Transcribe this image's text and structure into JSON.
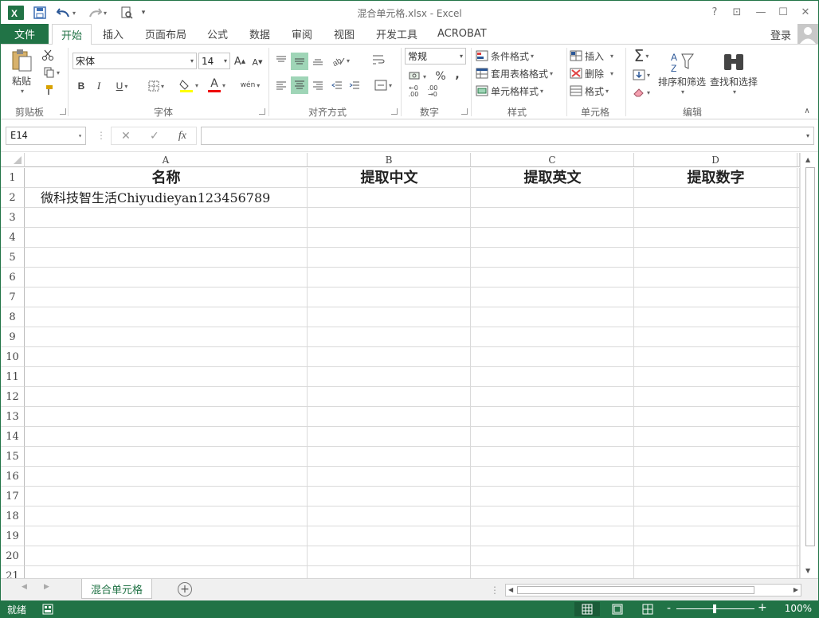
{
  "window": {
    "title": "混合单元格.xlsx - Excel",
    "help": "?",
    "restore_ribbon": "⊡",
    "minimize": "—",
    "maximize": "☐",
    "close": "✕"
  },
  "quick_access": {
    "app_icon": "X",
    "dropdown": "▾"
  },
  "ribbon_tabs": {
    "file": "文件",
    "home": "开始",
    "insert": "插入",
    "page_layout": "页面布局",
    "formulas": "公式",
    "data": "数据",
    "review": "审阅",
    "view": "视图",
    "developer": "开发工具",
    "acrobat": "ACROBAT",
    "login": "登录"
  },
  "clipboard": {
    "paste": "粘贴",
    "group": "剪贴板"
  },
  "font": {
    "name": "宋体",
    "size": "14",
    "bold": "B",
    "italic": "I",
    "underline": "U",
    "grow": "A",
    "shrink": "A",
    "font_color": "A",
    "phonetic": "wén",
    "group": "字体"
  },
  "alignment": {
    "group": "对齐方式"
  },
  "number": {
    "format": "常规",
    "percent": "%",
    "comma": ",",
    "group": "数字"
  },
  "styles": {
    "conditional": "条件格式",
    "table": "套用表格格式",
    "cell": "单元格样式",
    "group": "样式"
  },
  "cells": {
    "insert": "插入",
    "delete": "删除",
    "format": "格式",
    "group": "单元格"
  },
  "editing": {
    "sigma": "Σ",
    "sort": "排序和筛选",
    "find": "查找和选择",
    "group": "编辑"
  },
  "formula_bar": {
    "name_box": "E14",
    "cancel": "✕",
    "enter": "✓",
    "fx": "fx",
    "value": ""
  },
  "sheet": {
    "columns": [
      "A",
      "B",
      "C",
      "D"
    ],
    "rows": [
      "1",
      "2",
      "3",
      "4",
      "5",
      "6",
      "7",
      "8",
      "9",
      "10",
      "11",
      "12",
      "13",
      "14",
      "15",
      "16",
      "17",
      "18",
      "19",
      "20",
      "21"
    ],
    "headers": [
      "名称",
      "提取中文",
      "提取英文",
      "提取数字"
    ],
    "a2": "微科技智生活Chiyudieyan123456789"
  },
  "sheet_tabs": {
    "active": "混合单元格",
    "add": "+"
  },
  "status_bar": {
    "ready": "就绪",
    "zoom": "100%",
    "zoom_minus": "-",
    "zoom_plus": "+"
  }
}
